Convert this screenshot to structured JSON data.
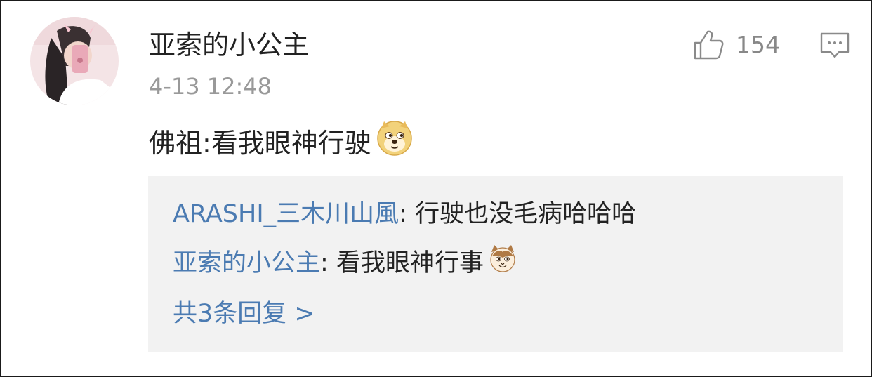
{
  "comment": {
    "username": "亚索的小公主",
    "time": "4-13 12:48",
    "text": "佛祖:看我眼神行驶",
    "text_emoji": "doge-emoji",
    "likes": "154",
    "avatar_icon": "avatar-photo",
    "like_icon": "thumbs-up-icon",
    "comment_icon": "comment-bubble-icon"
  },
  "replies": [
    {
      "name": "ARASHI_三木川山風",
      "separator": ": ",
      "text": "行驶也没毛病哈哈哈",
      "emoji": null
    },
    {
      "name": "亚索的小公主",
      "separator": ": ",
      "text": "看我眼神行事",
      "emoji": "cat-emoji"
    }
  ],
  "more_replies": "共3条回复 >",
  "colors": {
    "link": "#4b7bb2",
    "text": "#222222",
    "muted": "#999999",
    "reply_bg": "#f2f2f2"
  }
}
